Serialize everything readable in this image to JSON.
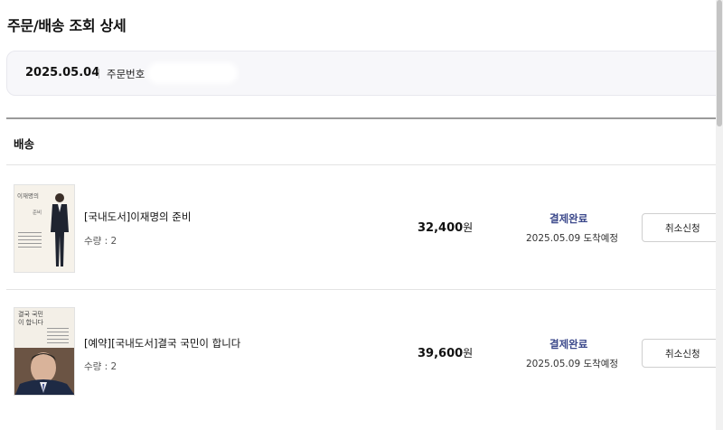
{
  "page": {
    "title": "주문/배송 조회 상세"
  },
  "order": {
    "date": "2025.05.04",
    "number_label": "주문번호"
  },
  "section": {
    "title": "배송"
  },
  "items": [
    {
      "title": "[국내도서]이재명의 준비",
      "quantity": "수량 : 2",
      "price": "32,400",
      "currency": "원",
      "status": "결제완료",
      "eta": "2025.05.09 도착예정",
      "cancel_label": "취소신청",
      "cover_text": "이재명의",
      "cover_sub": "준비"
    },
    {
      "title": "[예약][국내도서]결국 국민이 합니다",
      "quantity": "수량 : 2",
      "price": "39,600",
      "currency": "원",
      "status": "결제완료",
      "eta": "2025.05.09 도착예정",
      "cancel_label": "취소신청",
      "cover_text": "결국 국민이 합니다"
    }
  ],
  "colors": {
    "status": "#3d4a8c",
    "order_box_bg": "#f7f7fa"
  },
  "icons": [
    "order-number-mask"
  ]
}
